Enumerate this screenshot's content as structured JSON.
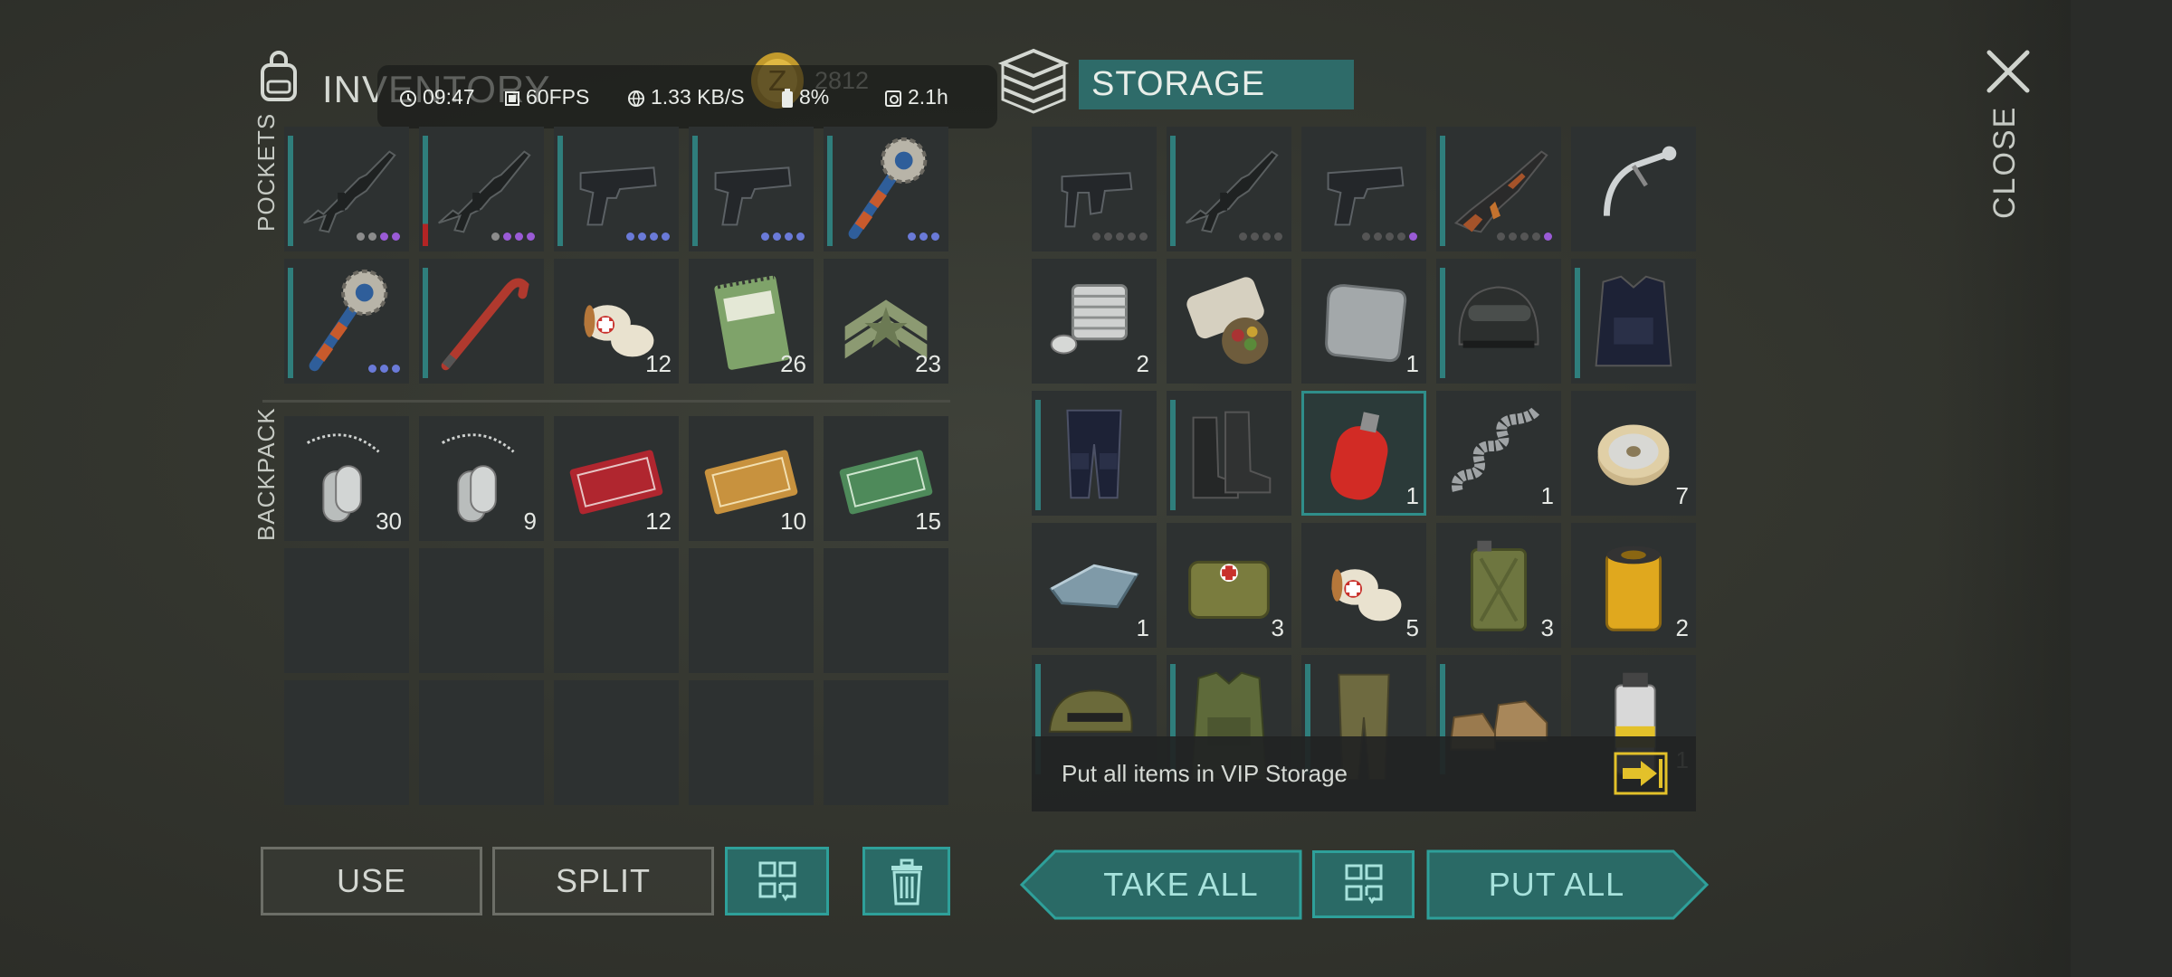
{
  "header": {
    "inventory_title": "INVENTORY",
    "storage_title": "STORAGE",
    "coins": "2812",
    "close_label": "CLOSE"
  },
  "status_overlay": {
    "time": "09:47",
    "fps": "60FPS",
    "network": "1.33 KB/S",
    "battery": "8%",
    "session": "2.1h"
  },
  "sections": {
    "pockets_label": "POCKETS",
    "backpack_label": "BACKPACK"
  },
  "pockets": [
    {
      "item": "assault-rifle",
      "qty": "",
      "bar": true,
      "dots": [
        "#8c8c8c",
        "#8c8c8c",
        "#9a5bd6",
        "#9a5bd6"
      ]
    },
    {
      "item": "assault-rifle",
      "qty": "",
      "bar": "red",
      "dots": [
        "#8c8c8c",
        "#9a5bd6",
        "#9a5bd6",
        "#9a5bd6"
      ]
    },
    {
      "item": "pistol",
      "qty": "",
      "bar": true,
      "dots": [
        "#6a7ad8",
        "#6a7ad8",
        "#6a7ad8",
        "#6a7ad8"
      ]
    },
    {
      "item": "pistol",
      "qty": "",
      "bar": true,
      "dots": [
        "#6a7ad8",
        "#6a7ad8",
        "#6a7ad8",
        "#6a7ad8"
      ]
    },
    {
      "item": "saw-mace",
      "qty": "",
      "bar": true,
      "dots": [
        "#6a7ad8",
        "#6a7ad8",
        "#6a7ad8"
      ]
    },
    {
      "item": "saw-mace",
      "qty": "",
      "bar": true,
      "dots": [
        "#6a7ad8",
        "#6a7ad8",
        "#6a7ad8"
      ]
    },
    {
      "item": "crowbar",
      "qty": "",
      "bar": true,
      "dots": []
    },
    {
      "item": "bandage",
      "qty": "12",
      "bar": false,
      "dots": []
    },
    {
      "item": "notebook",
      "qty": "26",
      "bar": false,
      "dots": []
    },
    {
      "item": "chevron-badge",
      "qty": "23",
      "bar": false,
      "dots": []
    }
  ],
  "backpack": [
    {
      "item": "dog-tags",
      "qty": "30"
    },
    {
      "item": "dog-tags",
      "qty": "9"
    },
    {
      "item": "coupon-red",
      "qty": "12"
    },
    {
      "item": "coupon-orange",
      "qty": "10"
    },
    {
      "item": "coupon-green",
      "qty": "15"
    },
    {
      "item": "",
      "qty": ""
    },
    {
      "item": "",
      "qty": ""
    },
    {
      "item": "",
      "qty": ""
    },
    {
      "item": "",
      "qty": ""
    },
    {
      "item": "",
      "qty": ""
    },
    {
      "item": "",
      "qty": ""
    },
    {
      "item": "",
      "qty": ""
    },
    {
      "item": "",
      "qty": ""
    },
    {
      "item": "",
      "qty": ""
    },
    {
      "item": "",
      "qty": ""
    }
  ],
  "storage": [
    {
      "item": "smg",
      "qty": "",
      "bar": false,
      "dots": [
        "#555",
        "#555",
        "#555",
        "#555",
        "#555"
      ]
    },
    {
      "item": "assault-rifle",
      "qty": "",
      "bar": true,
      "dots": [
        "#555",
        "#555",
        "#555",
        "#555"
      ]
    },
    {
      "item": "pistol",
      "qty": "",
      "bar": false,
      "dots": [
        "#555",
        "#555",
        "#555",
        "#555",
        "#9a5bd6"
      ]
    },
    {
      "item": "ak-rifle",
      "qty": "",
      "bar": true,
      "dots": [
        "#555",
        "#555",
        "#555",
        "#555",
        "#9a5bd6"
      ]
    },
    {
      "item": "handlebar",
      "qty": "",
      "bar": false,
      "dots": []
    },
    {
      "item": "engine-part",
      "qty": "2",
      "bar": false,
      "dots": []
    },
    {
      "item": "food-pack",
      "qty": "",
      "bar": false,
      "dots": []
    },
    {
      "item": "metal-plate",
      "qty": "1",
      "bar": false,
      "dots": []
    },
    {
      "item": "helmet",
      "qty": "",
      "bar": true,
      "dots": []
    },
    {
      "item": "vest",
      "qty": "",
      "bar": true,
      "dots": []
    },
    {
      "item": "pants",
      "qty": "",
      "bar": true,
      "dots": []
    },
    {
      "item": "boots",
      "qty": "",
      "bar": true,
      "dots": []
    },
    {
      "item": "gas-cylinder",
      "qty": "1",
      "bar": false,
      "dots": [],
      "selected": true
    },
    {
      "item": "spring",
      "qty": "1",
      "bar": false,
      "dots": []
    },
    {
      "item": "wire-spool",
      "qty": "7",
      "bar": false,
      "dots": []
    },
    {
      "item": "metal-ingot",
      "qty": "1",
      "bar": false,
      "dots": []
    },
    {
      "item": "medkit-bag",
      "qty": "3",
      "bar": false,
      "dots": []
    },
    {
      "item": "bandage",
      "qty": "5",
      "bar": false,
      "dots": []
    },
    {
      "item": "jerrycan",
      "qty": "3",
      "bar": false,
      "dots": []
    },
    {
      "item": "oil-filter",
      "qty": "2",
      "bar": false,
      "dots": []
    },
    {
      "item": "camo-cap",
      "qty": "",
      "bar": true,
      "dots": []
    },
    {
      "item": "camo-vest",
      "qty": "",
      "bar": true,
      "dots": []
    },
    {
      "item": "camo-pants",
      "qty": "",
      "bar": true,
      "dots": []
    },
    {
      "item": "shoes",
      "qty": "",
      "bar": true,
      "dots": []
    },
    {
      "item": "spray-paint",
      "qty": "1",
      "bar": false,
      "dots": []
    }
  ],
  "storage_tip": "Put all items in VIP Storage",
  "buttons": {
    "use": "USE",
    "split": "SPLIT",
    "take_all": "TAKE ALL",
    "put_all": "PUT ALL"
  },
  "colors": {
    "accent_teal": "#2f7e7c",
    "button_teal": "#2a6a66",
    "rarity_purple": "#9a5bd6",
    "rarity_blue": "#6a7ad8"
  }
}
